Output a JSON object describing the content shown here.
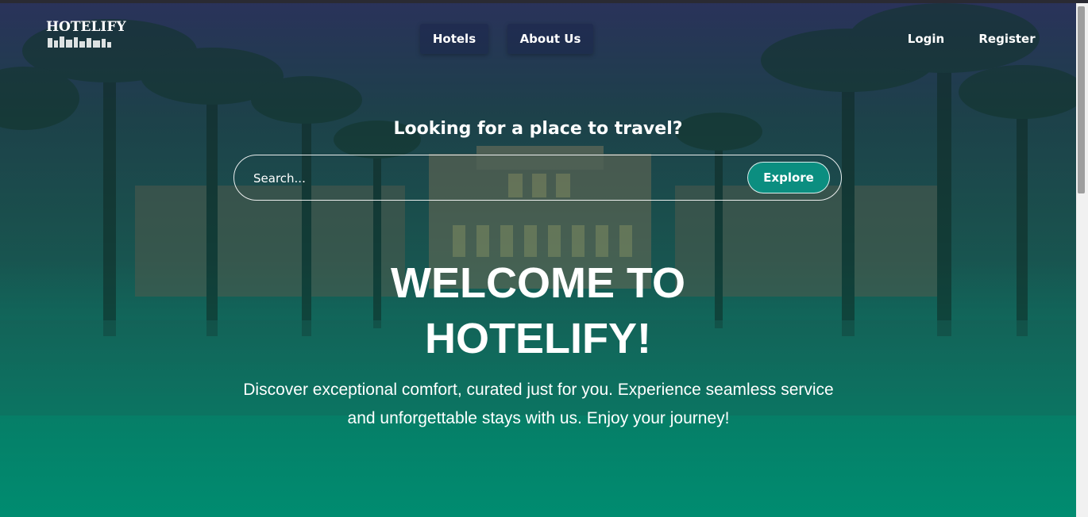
{
  "brand": {
    "logo_text": "HOTELIFY",
    "logo_icon": "skyline-icon"
  },
  "nav": {
    "center_links": [
      {
        "label": "Hotels"
      },
      {
        "label": "About Us"
      }
    ],
    "login_label": "Login",
    "register_label": "Register"
  },
  "search": {
    "tagline": "Looking for a place to travel?",
    "placeholder": "Search...",
    "value": "",
    "button_label": "Explore"
  },
  "hero": {
    "headline_line1": "WELCOME TO",
    "headline_line2": "HOTELIFY!",
    "description_line1": "Discover exceptional comfort, curated just for you. Experience seamless service",
    "description_line2": "and unforgettable stays with us. Enjoy your journey!"
  },
  "colors": {
    "accent": "#0b8e80",
    "gradient_top": "#2c3460",
    "gradient_bottom": "#008c70"
  }
}
